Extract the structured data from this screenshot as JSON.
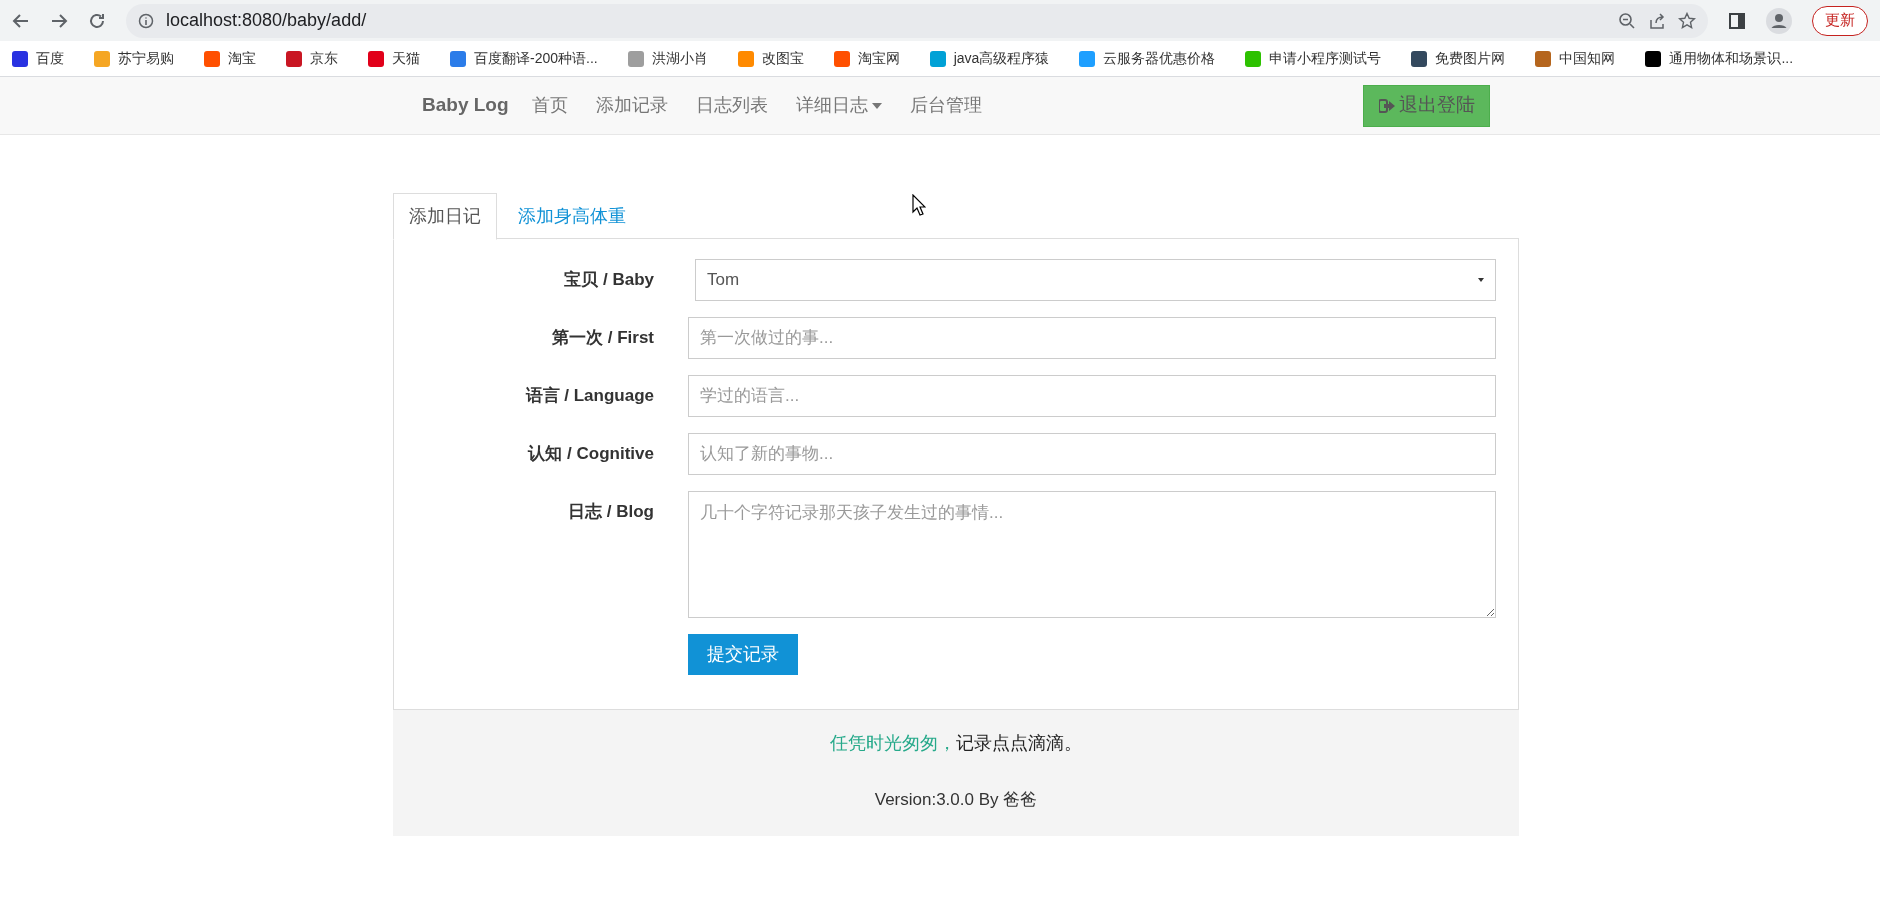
{
  "browser": {
    "url": "localhost:8080/baby/add/",
    "update_button": "更新",
    "bookmarks": [
      {
        "label": "百度",
        "color": "#2932e1"
      },
      {
        "label": "苏宁易购",
        "color": "#f5a623"
      },
      {
        "label": "淘宝",
        "color": "#ff5000"
      },
      {
        "label": "京东",
        "color": "#c91623"
      },
      {
        "label": "天猫",
        "color": "#e1001a"
      },
      {
        "label": "百度翻译-200种语...",
        "color": "#2b7ce9"
      },
      {
        "label": "洪湖小肖",
        "color": "#9e9e9e"
      },
      {
        "label": "改图宝",
        "color": "#ff8a00"
      },
      {
        "label": "淘宝网",
        "color": "#ff5000"
      },
      {
        "label": "java高级程序猿",
        "color": "#00a1d6"
      },
      {
        "label": "云服务器优惠价格",
        "color": "#1e9fff"
      },
      {
        "label": "申请小程序测试号",
        "color": "#2dc100"
      },
      {
        "label": "免费图片网",
        "color": "#34495e"
      },
      {
        "label": "中国知网",
        "color": "#b5651d"
      },
      {
        "label": "通用物体和场景识...",
        "color": "#000000"
      }
    ]
  },
  "navbar": {
    "brand": "Baby Log",
    "items": [
      {
        "label": "首页",
        "dropdown": false
      },
      {
        "label": "添加记录",
        "dropdown": false
      },
      {
        "label": "日志列表",
        "dropdown": false
      },
      {
        "label": "详细日志",
        "dropdown": true
      },
      {
        "label": "后台管理",
        "dropdown": false
      }
    ],
    "logout_button": "退出登陆"
  },
  "tabs": [
    {
      "label": "添加日记",
      "selected": true
    },
    {
      "label": "添加身高体重",
      "selected": false
    }
  ],
  "form": {
    "fields": [
      {
        "kind": "select",
        "label": "宝贝 / Baby",
        "value": "Tom"
      },
      {
        "kind": "input",
        "label": "第一次 / First",
        "placeholder": "第一次做过的事..."
      },
      {
        "kind": "input",
        "label": "语言 / Language",
        "placeholder": "学过的语言..."
      },
      {
        "kind": "input",
        "label": "认知 / Cognitive",
        "placeholder": "认知了新的事物..."
      },
      {
        "kind": "textarea",
        "label": "日志 / Blog",
        "placeholder": "几十个字符记录那天孩子发生过的事情..."
      }
    ],
    "submit_button": "提交记录"
  },
  "footer": {
    "slogan": [
      {
        "text": "任凭时光匆匆，",
        "accent": true
      },
      {
        "text": "记录点点滴滴。",
        "accent": false
      }
    ],
    "version": "Version:3.0.0 By 爸爸"
  }
}
